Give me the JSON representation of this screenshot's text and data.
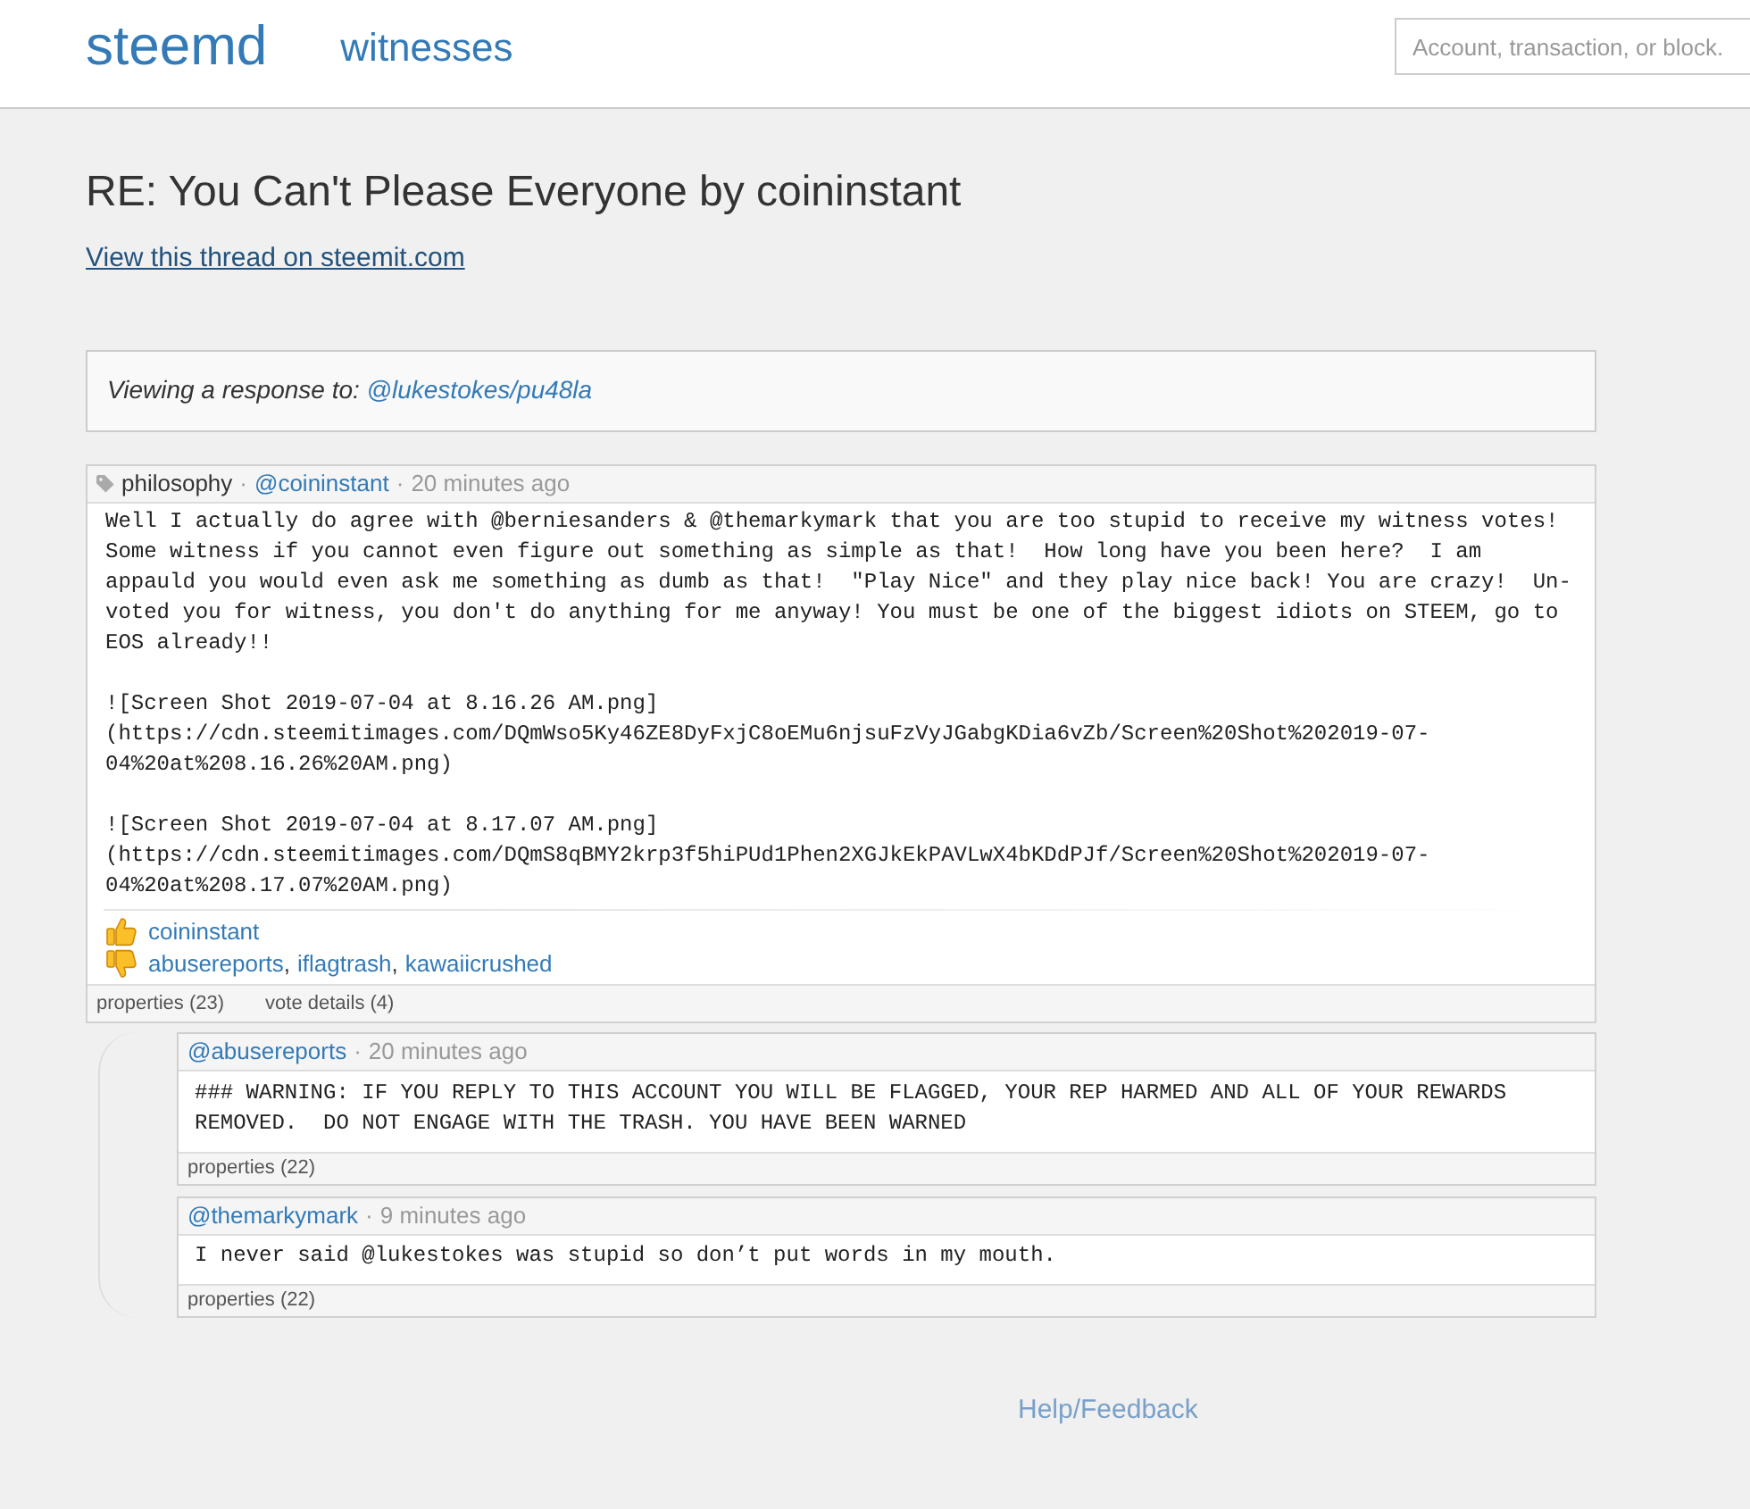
{
  "header": {
    "logo": "steemd",
    "nav": [
      {
        "label": "witnesses"
      }
    ],
    "search": {
      "placeholder": "Account, transaction, or block."
    }
  },
  "title": "RE: You Can't Please Everyone by coininstant",
  "thread_link": "View this thread on steemit.com",
  "context": {
    "label": "Viewing a response to:",
    "link": "@lukestokes/pu48la"
  },
  "post": {
    "meta": [
      {
        "kind": "tag",
        "text": "philosophy"
      },
      {
        "kind": "separator",
        "text": "·"
      },
      {
        "kind": "author",
        "text": "@coininstant"
      },
      {
        "kind": "separator",
        "text": "·"
      },
      {
        "kind": "time",
        "text": "20 minutes ago"
      }
    ],
    "body": "Well I actually do agree with @berniesanders & @themarkymark that you are too stupid to receive my witness votes!\nSome witness if you cannot even figure out something as simple as that!  How long have you been here?  I am\nappauld you would even ask me something as dumb as that!  \"Play Nice\" and they play nice back! You are crazy!  Un-\nvoted you for witness, you don't do anything for me anyway! You must be one of the biggest idiots on STEEM, go to\nEOS already!!\n\n![Screen Shot 2019-07-04 at 8.16.26 AM.png]\n(https://cdn.steemitimages.com/DQmWso5Ky46ZE8DyFxjC8oEMu6njsuFzVyJGabgKDia6vZb/Screen%20Shot%202019-07-\n04%20at%208.16.26%20AM.png)\n\n![Screen Shot 2019-07-04 at 8.17.07 AM.png]\n(https://cdn.steemitimages.com/DQmS8qBMY2krp3f5hiPUd1Phen2XGJkEkPAVLwX4bKDdPJf/Screen%20Shot%202019-07-\n04%20at%208.17.07%20AM.png)",
    "voter_separator": ",",
    "votes": [
      {
        "kind": "up",
        "voters": [
          "coininstant"
        ]
      },
      {
        "kind": "down",
        "voters": [
          "abusereports",
          "iflagtrash",
          "kawaiicrushed"
        ]
      }
    ],
    "tabs": [
      {
        "label": "properties (23)"
      },
      {
        "label": "vote details (4)"
      }
    ]
  },
  "replies": [
    {
      "meta": [
        {
          "kind": "author",
          "text": "@abusereports"
        },
        {
          "kind": "separator",
          "text": "·"
        },
        {
          "kind": "time",
          "text": "20 minutes ago"
        }
      ],
      "body": "### WARNING: IF YOU REPLY TO THIS ACCOUNT YOU WILL BE FLAGGED, YOUR REP HARMED AND ALL OF YOUR REWARDS\nREMOVED.  DO NOT ENGAGE WITH THE TRASH. YOU HAVE BEEN WARNED",
      "tabs": [
        {
          "label": "properties (22)"
        }
      ]
    },
    {
      "meta": [
        {
          "kind": "author",
          "text": "@themarkymark"
        },
        {
          "kind": "separator",
          "text": "·"
        },
        {
          "kind": "time",
          "text": "9 minutes ago"
        }
      ],
      "body": "I never said @lukestokes was stupid so don’t put words in my mouth.",
      "tabs": [
        {
          "label": "properties (22)"
        }
      ]
    }
  ],
  "footer": {
    "link": "Help/Feedback"
  }
}
